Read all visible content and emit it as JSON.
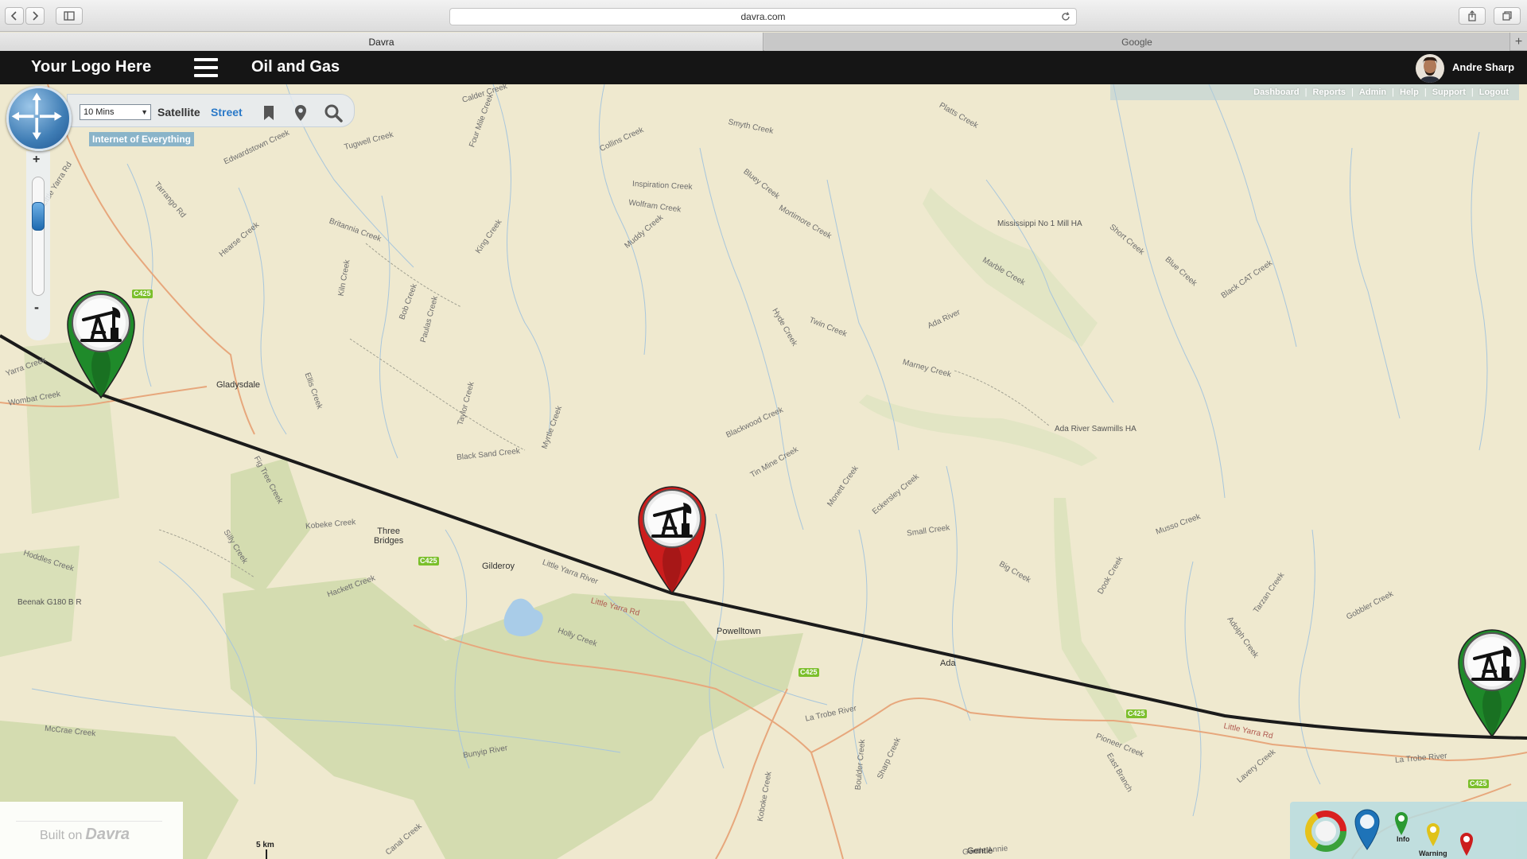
{
  "browser": {
    "url": "davra.com",
    "tabs": [
      {
        "label": "Davra",
        "active": true
      },
      {
        "label": "Google",
        "active": false
      }
    ],
    "new_tab": "+"
  },
  "header": {
    "logo": "Your Logo Here",
    "title": "Oil and Gas",
    "user_name": "Andre Sharp"
  },
  "top_nav": {
    "items": [
      "Dashboard",
      "Reports",
      "Admin",
      "Help",
      "Support",
      "Logout"
    ]
  },
  "map_toolbar": {
    "time_window": "10 Mins",
    "satellite_label": "Satellite",
    "street_label": "Street",
    "active_view": "Street",
    "badge": "Internet of Everything",
    "zoom_in": "+",
    "zoom_out": "-",
    "zoom_level_fraction": 0.28
  },
  "map": {
    "towns": [
      {
        "name": "Gladysdale"
      },
      {
        "name": "Three\nBridges"
      },
      {
        "name": "Gilderoy"
      },
      {
        "name": "Powelltown"
      },
      {
        "name": "Ada"
      },
      {
        "name": "Gentle"
      }
    ],
    "features": [
      "Calder Creek",
      "Little Yarra Rd",
      "Four Mile Creek",
      "Collins Creek",
      "Smyth Creek",
      "Platts Creek",
      "Tarrango Rd",
      "Edwardstown Creek",
      "Tugwell Creek",
      "Inspiration Creek",
      "Bluey Creek",
      "Mississippi No 1 Mill\nHA",
      "Britannia Creek",
      "Hearse Creek",
      "King Creek",
      "Wolfram Creek",
      "Muddy Creek",
      "Mortimore Creek",
      "Marble Creek",
      "Short Creek",
      "Blue Creek",
      "Black CAT Creek",
      "Twin Creek",
      "Hyde Creek",
      "Ada River",
      "Bob Creek",
      "Paulas Creek",
      "Kiln Creek",
      "Ellis Creek",
      "Taylor Creek",
      "Black Sand Creek",
      "Myrtle Creek",
      "Blackwood Creek",
      "Marney Creek",
      "Ada River\nSawmills\nHA",
      "Wombat Creek",
      "Yarra Creek",
      "Fig Tree Creek",
      "Kobeke Creek",
      "Silly Creek",
      "Hoddles Creek",
      "Beenak\nG180 B R",
      "Little Yarra River",
      "Little Yarra Rd",
      "Hackett Creek",
      "Holly Creek",
      "Tin Mine Creek",
      "Monett Creek",
      "Eckersley Creek",
      "Small Creek",
      "Big Creek",
      "Dook Creek",
      "Musso Creek",
      "Gobbler Creek",
      "La Trobe River",
      "Pioneer Creek",
      "East Branch",
      "McCrae Creek",
      "Bunyip River",
      "Boulder Creek",
      "Sharp Creek",
      "Koboke Creek",
      "Canal Creek",
      "Lavery Creek",
      "Little Yarra Rd",
      "La Trobe River",
      "Tarzan Creek",
      "Adolph Creek",
      "Gentle Annie"
    ],
    "road_shields": [
      "C425",
      "C425",
      "C425",
      "C425",
      "C425"
    ]
  },
  "markers": [
    {
      "name": "well-marker-west",
      "status": "ok",
      "color": "#1f8a2a"
    },
    {
      "name": "well-marker-central",
      "status": "alert",
      "color": "#cc1d1d"
    },
    {
      "name": "well-marker-east",
      "status": "ok",
      "color": "#1f8a2a"
    }
  ],
  "footer": {
    "built_on_prefix": "Built on",
    "built_on_brand": "Davra",
    "scale": "5 km"
  },
  "legend": {
    "info": "Info",
    "warning": "Warning"
  },
  "colors": {
    "header_bg": "#151515",
    "accent_blue": "#2a79c8",
    "ok_green": "#1f8a2a",
    "alert_red": "#cc1d1d",
    "map_bg": "#efe9cf",
    "forest": "#d4dcb0"
  }
}
